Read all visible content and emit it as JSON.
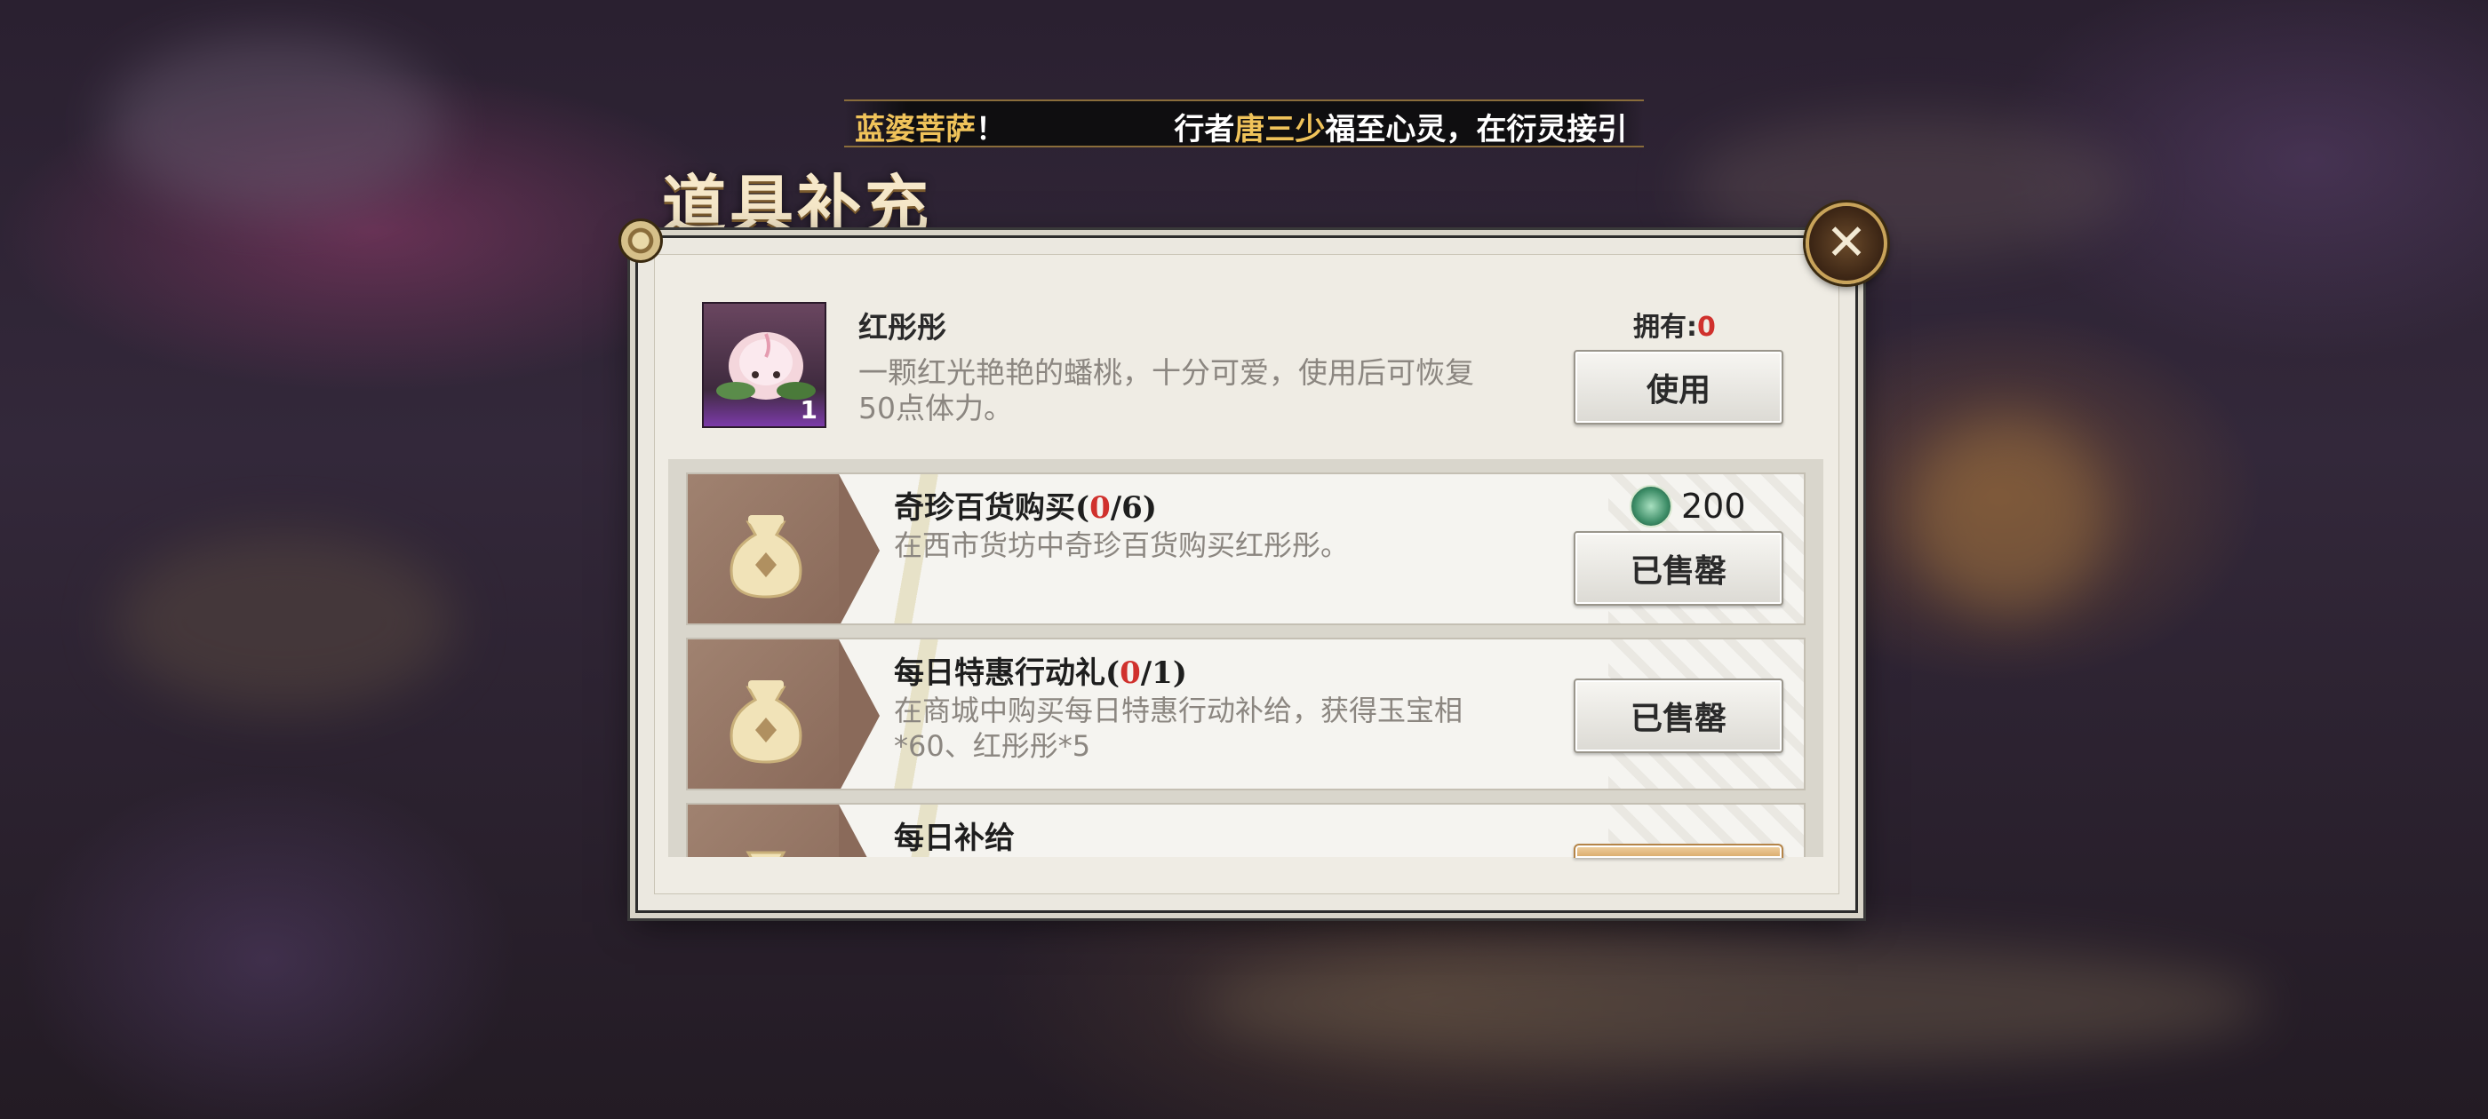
{
  "marquee": {
    "part1": "蓝婆菩萨",
    "part2": "！",
    "part3": "行者",
    "part4": "唐三少",
    "part5": "福至心灵，在衍灵接引"
  },
  "title": "道具补充",
  "item": {
    "name": "红彤彤",
    "description": "一颗红光艳艳的蟠桃，十分可爱，使用后可恢复50点体力。",
    "count": "1",
    "owned_label": "拥有:",
    "owned_value": "0",
    "use_button": "使用"
  },
  "rows": [
    {
      "title": "奇珍百货购买(",
      "current": "0",
      "rest": "/6)",
      "description": "在西市货坊中奇珍百货购买红彤彤。",
      "price": "200",
      "button": "已售罄"
    },
    {
      "title": "每日特惠行动礼(",
      "current": "0",
      "rest": "/1)",
      "description": "在商城中购买每日特惠行动补给，获得玉宝相*60、红彤彤*5",
      "button": "已售罄"
    },
    {
      "title": "每日补给"
    }
  ],
  "colors": {
    "accent_gold": "#f0c35a",
    "red_value": "#d0312d"
  }
}
